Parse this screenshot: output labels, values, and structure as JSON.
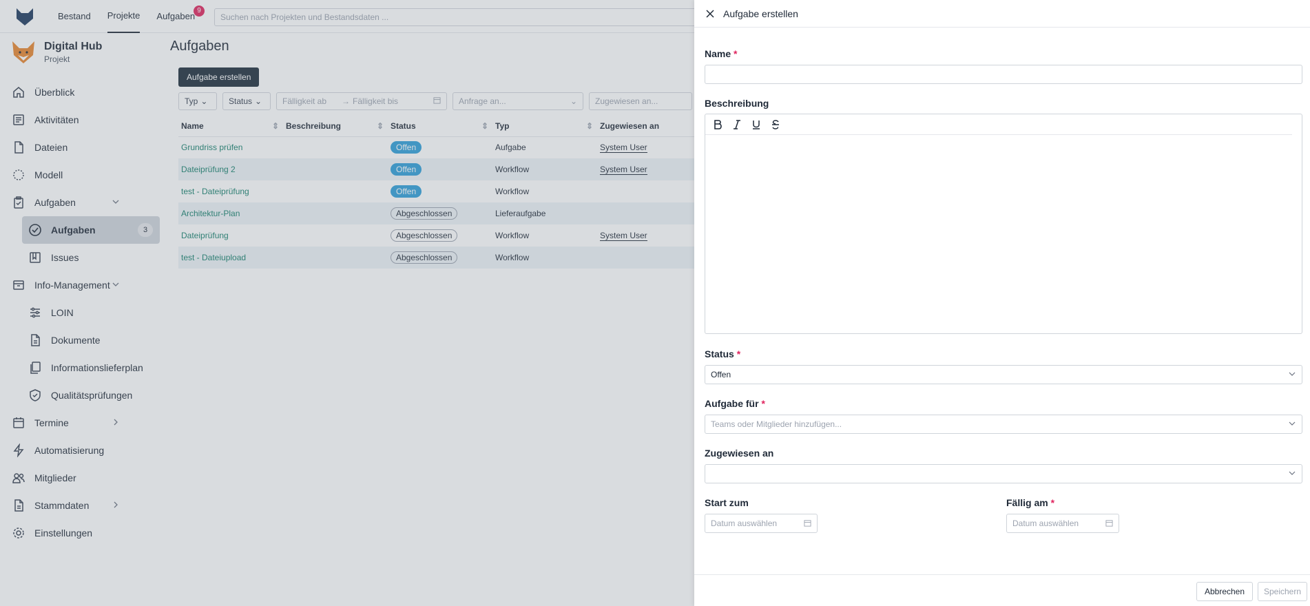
{
  "topbar": {
    "nav": [
      "Bestand",
      "Projekte",
      "Aufgaben"
    ],
    "active": "Projekte",
    "tasks_badge": "9",
    "search_placeholder": "Suchen nach Projekten und Bestandsdaten ..."
  },
  "sidebar": {
    "project_name": "Digital Hub",
    "project_sub": "Projekt",
    "items": {
      "overview": "Überblick",
      "activities": "Aktivitäten",
      "files": "Dateien",
      "model": "Modell",
      "tasks_group": "Aufgaben",
      "tasks": "Aufgaben",
      "tasks_count": "3",
      "issues": "Issues",
      "info_mgmt": "Info-Management",
      "loin": "LOIN",
      "documents": "Dokumente",
      "delivery_plan": "Informationslieferplan",
      "quality_checks": "Qualitätsprüfungen",
      "appointments": "Termine",
      "automation": "Automatisierung",
      "members": "Mitglieder",
      "master_data": "Stammdaten",
      "settings": "Einstellungen"
    }
  },
  "main": {
    "title": "Aufgaben",
    "create_button": "Aufgabe erstellen",
    "filters": {
      "type": "Typ",
      "status": "Status",
      "due_from": "Fälligkeit ab",
      "arrow": "→",
      "due_to": "Fälligkeit bis",
      "request_to": "Anfrage an...",
      "assigned_to": "Zugewiesen an..."
    },
    "columns": [
      "Name",
      "Beschreibung",
      "Status",
      "Typ",
      "Zugewiesen an"
    ],
    "rows": [
      {
        "name": "Grundriss prüfen",
        "status": "Offen",
        "type": "Aufgabe",
        "assignee": "System User"
      },
      {
        "name": "Dateiprüfung 2",
        "status": "Offen",
        "type": "Workflow",
        "assignee": "System User"
      },
      {
        "name": "test - Dateiprüfung",
        "status": "Offen",
        "type": "Workflow",
        "assignee": ""
      },
      {
        "name": "Architektur-Plan",
        "status": "Abgeschlossen",
        "type": "Lieferaufgabe",
        "assignee": ""
      },
      {
        "name": "Dateiprüfung",
        "status": "Abgeschlossen",
        "type": "Workflow",
        "assignee": "System User"
      },
      {
        "name": "test - Dateiupload",
        "status": "Abgeschlossen",
        "type": "Workflow",
        "assignee": ""
      }
    ]
  },
  "drawer": {
    "title": "Aufgabe erstellen",
    "name_label": "Name",
    "required_mark": "*",
    "description_label": "Beschreibung",
    "status_label": "Status",
    "status_value": "Offen",
    "task_for_label": "Aufgabe für",
    "task_for_placeholder": "Teams oder Mitglieder hinzufügen...",
    "assigned_label": "Zugewiesen an",
    "start_label": "Start zum",
    "due_label": "Fällig am",
    "date_placeholder": "Datum auswählen",
    "cancel": "Abbrechen",
    "save": "Speichern"
  },
  "colors": {
    "accent_dark": "#1e2d3b",
    "link": "#17806d",
    "status_open": "#2f9fd8",
    "required": "#e0245e"
  }
}
